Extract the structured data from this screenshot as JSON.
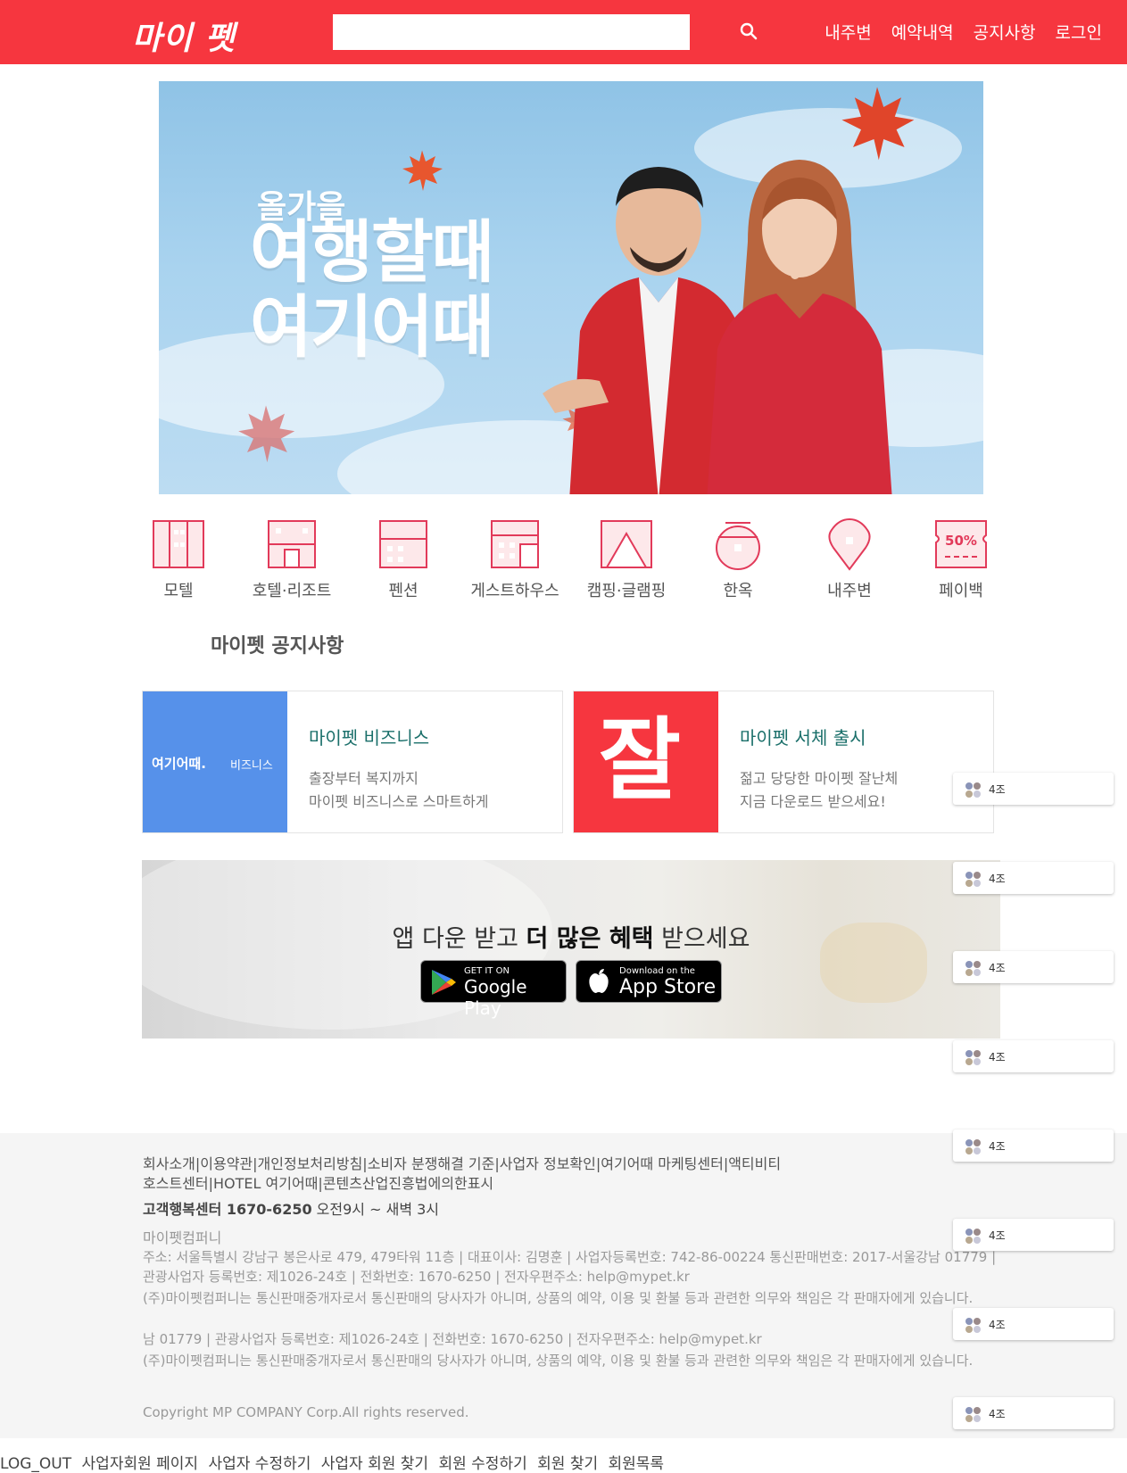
{
  "header": {
    "logo": "마이 펫",
    "search": {
      "placeholder": "",
      "value": ""
    },
    "nav": [
      "내주변",
      "예약내역",
      "공지사항",
      "로그인"
    ]
  },
  "banner": {
    "line_small": "올가을",
    "line1": "여행할때",
    "line2": "여기어때"
  },
  "categories": [
    {
      "label": "모텔",
      "icon": "motel-icon"
    },
    {
      "label": "호텔·리조트",
      "icon": "hotel-icon"
    },
    {
      "label": "펜션",
      "icon": "pension-icon"
    },
    {
      "label": "게스트하우스",
      "icon": "guesthouse-icon"
    },
    {
      "label": "캠핑·글램핑",
      "icon": "camping-icon"
    },
    {
      "label": "한옥",
      "icon": "hanok-icon"
    },
    {
      "label": "내주변",
      "icon": "location-pin-icon"
    },
    {
      "label": "페이백",
      "icon": "payback-icon",
      "badge_text": "50%"
    }
  ],
  "notice_title": "마이펫 공지사항",
  "cards": [
    {
      "title": "마이펫 비즈니스",
      "desc1": "출장부터 복지까지",
      "desc2": "마이펫 비즈니스로 스마트하게",
      "thumb_logo": "여기어때.",
      "thumb_sub": "비즈니스",
      "thumb_color": "#5691ea"
    },
    {
      "title": "마이펫 서체 출시",
      "desc1": "젊고 당당한 마이펫 잘난체",
      "desc2": "지금 다운로드 받으세요!",
      "thumb_char": "잘",
      "thumb_color": "#f6363f"
    }
  ],
  "app_banner": {
    "text_pre": "앱 다운 받고 ",
    "text_bold": "더 많은 혜택",
    "text_post": " 받으세요",
    "google_small": "GET IT ON",
    "google_big": "Google Play",
    "apple_small": "Download on the",
    "apple_big": "App Store"
  },
  "footer": {
    "links": "회사소개|이용약관|개인정보처리방침|소비자 분쟁해결 기준|사업자 정보확인|여기어때 마케팅센터|액티비티 호스트센터|HOTEL 여기어때|콘텐츠산업진흥법에의한표시",
    "cs_label": "고객행복센터 1670-6250",
    "cs_hours": " 오전9시 ~ 새벽 3시",
    "company": "마이펫컴퍼니",
    "address": "주소: 서울특별시 강남구 봉은사로 479, 479타워 11층 | 대표이사: 김명훈 | 사업자등록번호: 742-86-00224 통신판매번호: 2017-서울강남 01779 | 관광사업자 등록번호: 제1026-24호 | 전화번호: 1670-6250 | 전자우편주소: help@mypet.kr",
    "disclaimer": "(주)마이펫컴퍼니는 통신판매중개자로서 통신판매의 당사자가 아니며, 상품의 예약, 이용 및 환불 등과 관련한 의무와 책임은 각 판매자에게 있습니다.",
    "overlap_line": "남 01779 | 관광사업자 등록번호: 제1026-24호 | 전화번호: 1670-6250 | 전자우편주소: help@mypet.kr",
    "overlap_disclaimer": "(주)마이펫컴퍼니는 통신판매중개자로서 통신판매의 당사자가 아니며, 상품의 예약, 이용 및 환불 등과 관련한 의무와 책임은 각 판매자에게 있습니다.",
    "copyright": "Copyright MP COMPANY Corp.All rights reserved."
  },
  "admin_links": [
    "LOG_OUT",
    "사업자회원 페이지",
    "사업자 수정하기",
    "사업자 회원 찾기",
    "회원 수정하기",
    "회원 찾기",
    "회원목록"
  ],
  "floating_badges": [
    "4조",
    "4조",
    "4조",
    "4조",
    "4조",
    "4조",
    "4조",
    "4조"
  ],
  "colors": {
    "brand": "#f6363f",
    "card_title": "#1a6f6a",
    "icon": "#e23a5a"
  }
}
